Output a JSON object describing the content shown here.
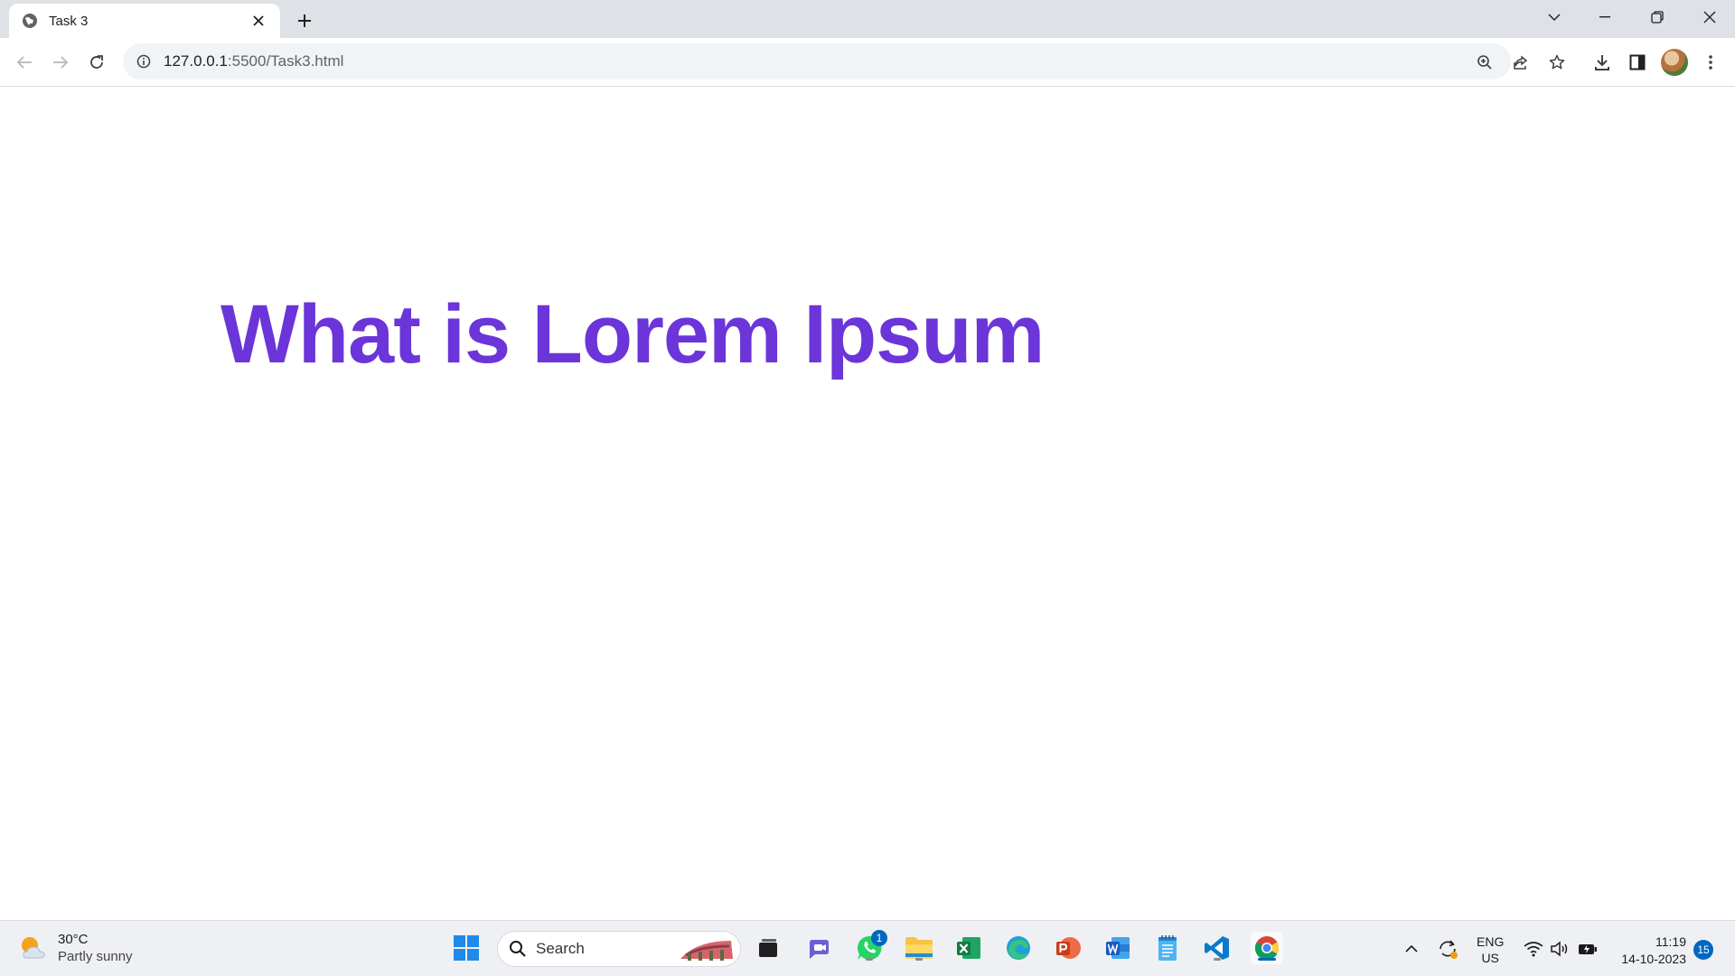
{
  "browser": {
    "tab": {
      "title": "Task 3",
      "favicon": "globe-icon"
    },
    "new_tab_icon": "plus-icon",
    "window_controls": [
      "chevron-down-icon",
      "minimize-icon",
      "restore-icon",
      "close-icon"
    ],
    "address": {
      "host": "127.0.0.1",
      "rest": ":5500/Task3.html"
    },
    "toolbar_icons": [
      "zoom-icon",
      "share-icon",
      "star-icon",
      "download-icon",
      "side-panel-icon",
      "avatar",
      "menu-icon"
    ]
  },
  "page": {
    "heading": "What is Lorem Ipsum",
    "heading_color": "#6b35d9"
  },
  "taskbar": {
    "weather": {
      "temp": "30°C",
      "desc": "Partly sunny"
    },
    "search_label": "Search",
    "whatsapp_badge": "1",
    "lang_line1": "ENG",
    "lang_line2": "US",
    "time": "11:19",
    "date": "14-10-2023",
    "notification_count": "15",
    "accent": "#0067c0"
  }
}
